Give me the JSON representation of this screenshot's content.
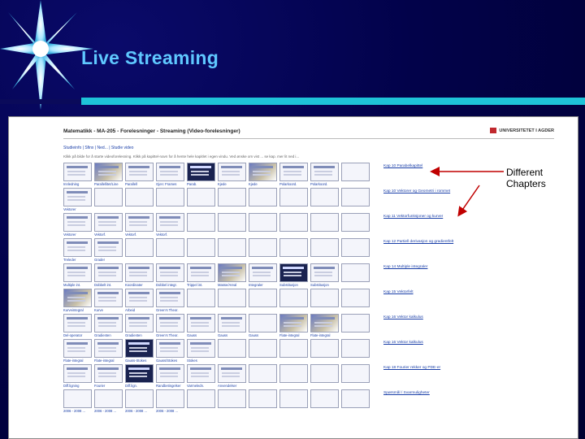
{
  "slide": {
    "title": "Live Streaming",
    "annotation": "Different Chapters",
    "colors": {
      "background": "#000030",
      "title": "#5fc8ff",
      "accent_bar": "#1ec3d8",
      "annotation_arrow": "#c00000"
    }
  },
  "screenshot": {
    "page_title": "Matematikk - MA-205 - Forelesninger - Streaming (Video-forelesninger)",
    "university": "UNIVERSITETET I AGDER",
    "nav": "Studieinfo | Sfinx | Ned... | Studie video",
    "intro": "Klikk på bilde for å starte videoforelesning. Klikk på kapittel-navn for å hente hele kapitlet i egen vindu. Ved ønske om vist ... se kap. mer lit ned i...",
    "rows": [
      {
        "labels": [
          "Innledning",
          "Parallellitet/Line",
          "Parallell",
          "Gjen: Frames",
          "Parab.",
          "Kjede",
          "Kjede",
          "Polarkoord.",
          "Polarkoord.",
          ""
        ],
        "kinds": [
          "has",
          "photo",
          "has",
          "has",
          "dark",
          "has",
          "photo",
          "has",
          "has",
          "empty"
        ]
      },
      {
        "labels": [
          "Vektorer",
          "",
          "",
          "",
          "",
          "",
          "",
          "",
          "",
          ""
        ],
        "kinds": [
          "has",
          "empty",
          "empty",
          "empty",
          "empty",
          "empty",
          "empty",
          "empty",
          "empty",
          "empty"
        ]
      },
      {
        "labels": [
          "Vektorer",
          "Vektorf.",
          "Vektorf.",
          "Vektorf.",
          "",
          "",
          "",
          "",
          "",
          ""
        ],
        "kinds": [
          "has",
          "has",
          "has",
          "has",
          "empty",
          "empty",
          "empty",
          "empty",
          "empty",
          "empty"
        ]
      },
      {
        "labels": [
          "Treleder",
          "Grader",
          "",
          "",
          "",
          "",
          "",
          "",
          "",
          ""
        ],
        "kinds": [
          "has",
          "has",
          "empty",
          "empty",
          "empty",
          "empty",
          "empty",
          "empty",
          "empty",
          "empty"
        ]
      },
      {
        "labels": [
          "Multiple int.",
          "Dobbelt int.",
          "Koordinater",
          "Dobbel integr.",
          "Trippel int.",
          "Masse/Areal",
          "Integraler",
          "Substitusjon",
          "Substitusjon",
          ""
        ],
        "kinds": [
          "has",
          "has",
          "has",
          "has",
          "has",
          "photo",
          "has",
          "dark",
          "has",
          "empty"
        ]
      },
      {
        "labels": [
          "Kurveintegral",
          "Kurve",
          "Arbeid",
          "Green's Theor.",
          "",
          "",
          "",
          "",
          "",
          ""
        ],
        "kinds": [
          "photo",
          "has",
          "has",
          "has",
          "empty",
          "empty",
          "empty",
          "empty",
          "empty",
          "empty"
        ]
      },
      {
        "labels": [
          "Del-operator",
          "Gradienten",
          "Gradienten",
          "Green's Theor.",
          "Gauss",
          "Gauss",
          "Gauss",
          "Flate-integral",
          "Flate-integral",
          ""
        ],
        "kinds": [
          "has",
          "has",
          "has",
          "has",
          "has",
          "has",
          "empty",
          "photo",
          "photo",
          "empty"
        ]
      },
      {
        "labels": [
          "Flate-integral",
          "Flate-integral",
          "Gauss-Stokes",
          "Gauss/Stokes",
          "Stokes",
          "",
          "",
          "",
          "",
          ""
        ],
        "kinds": [
          "has",
          "has",
          "dark",
          "has",
          "has",
          "empty",
          "empty",
          "empty",
          "empty",
          "empty"
        ]
      },
      {
        "labels": [
          "Diff.ligning",
          "Fourier",
          "Diff.lign.",
          "Randbetingelser",
          "Varmeledn.",
          "Anvendelser",
          "",
          "",
          "",
          ""
        ],
        "kinds": [
          "has",
          "has",
          "dark",
          "has",
          "has",
          "has",
          "empty",
          "empty",
          "empty",
          "empty"
        ]
      },
      {
        "labels": [
          "2006 - 2008 ...",
          "2006 - 2008 ...",
          "2006 - 2008 ...",
          "2006 - 2008 ...",
          "",
          "",
          "",
          "",
          "",
          ""
        ],
        "kinds": [
          "empty",
          "empty",
          "empty",
          "empty",
          "empty",
          "empty",
          "empty",
          "empty",
          "empty",
          "empty"
        ]
      }
    ],
    "chapters": [
      "Kap 10 Parabelkapittel",
      "Kap 10 Vektorer og Geometri i rommet",
      "Kap 11 Vektorfunksjoner og kurver",
      "Kap 12 Partiell derivasjon og gradientfelt",
      "Kap 14 Multiple integraler",
      "Kap 15 Vektorfelt",
      "Kap 16 Vektor kalkulus",
      "Kap 16 Vektor kalkulus",
      "Kap 18 Fourier rekker og PDE-er",
      "Spørsmål / Svarmuligheter"
    ]
  }
}
